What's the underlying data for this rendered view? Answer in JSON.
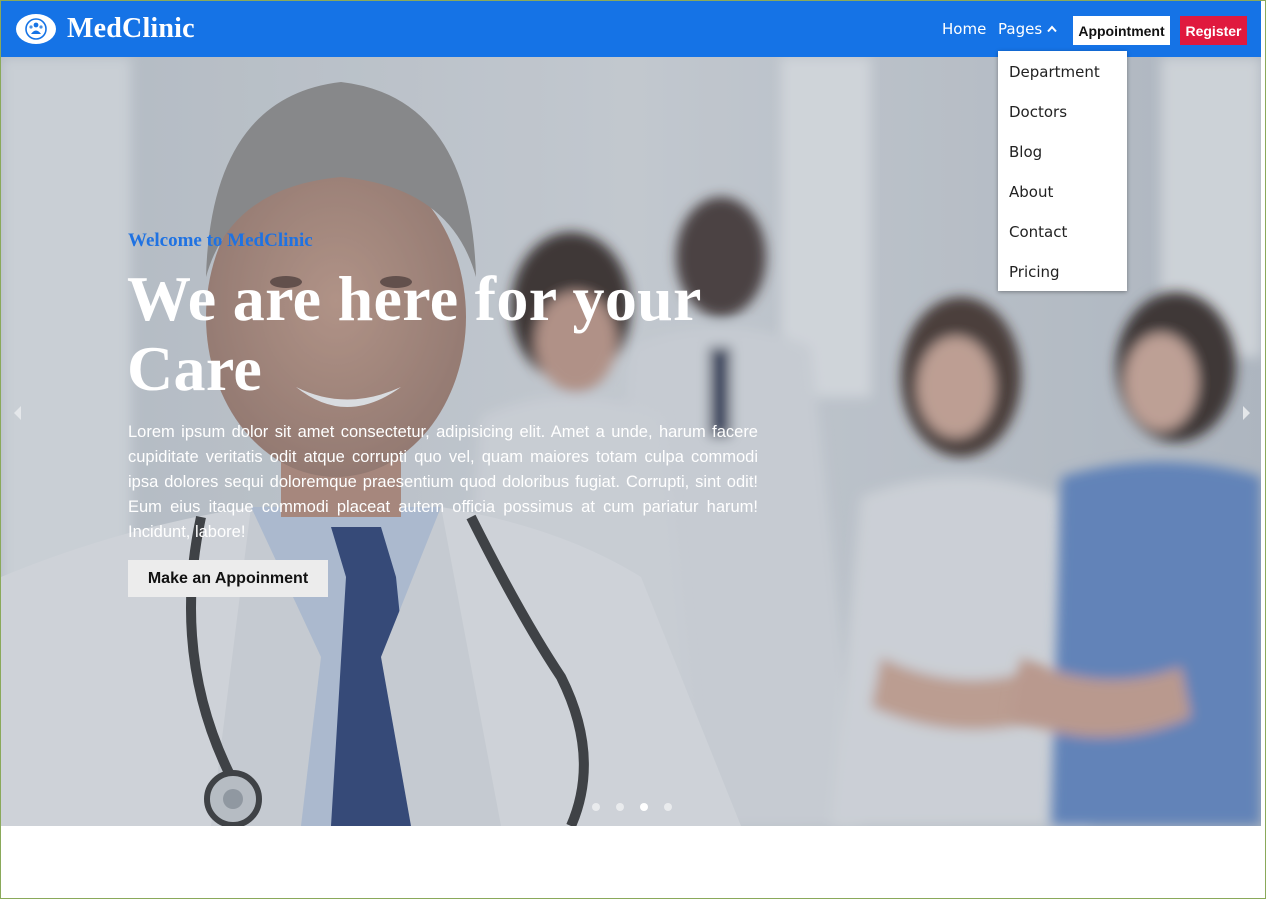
{
  "brand": {
    "name": "MedClinic",
    "logo_icon": "hospital-logo-icon"
  },
  "nav": {
    "home": "Home",
    "pages": "Pages",
    "pages_caret_icon": "chevron-up-icon",
    "appointment": "Appointment",
    "register": "Register"
  },
  "dropdown": {
    "items": [
      {
        "label": "Department"
      },
      {
        "label": "Doctors"
      },
      {
        "label": "Blog"
      },
      {
        "label": "About"
      },
      {
        "label": "Contact"
      },
      {
        "label": "Pricing"
      }
    ]
  },
  "hero": {
    "subtitle": "Welcome to MedClinic",
    "title": "We are here for your Care",
    "text": "Lorem ipsum dolor sit amet consectetur, adipisicing elit. Amet a unde, harum facere cupiditate veritatis odit atque corrupti quo vel, quam maiores totam culpa commodi ipsa dolores sequi doloremque praesentium quod doloribus fugiat. Corrupti, sint odit! Eum eius itaque commodi placeat autem officia possimus at cum pariatur harum! Incidunt, labore!",
    "button": "Make an Appoinment",
    "prev_icon": "chevron-left-icon",
    "next_icon": "chevron-right-icon",
    "slides_count": 4,
    "active_slide": 3
  },
  "colors": {
    "navbar": "#1573e6",
    "register": "#e0193e",
    "subtitle": "#1f72e2"
  }
}
